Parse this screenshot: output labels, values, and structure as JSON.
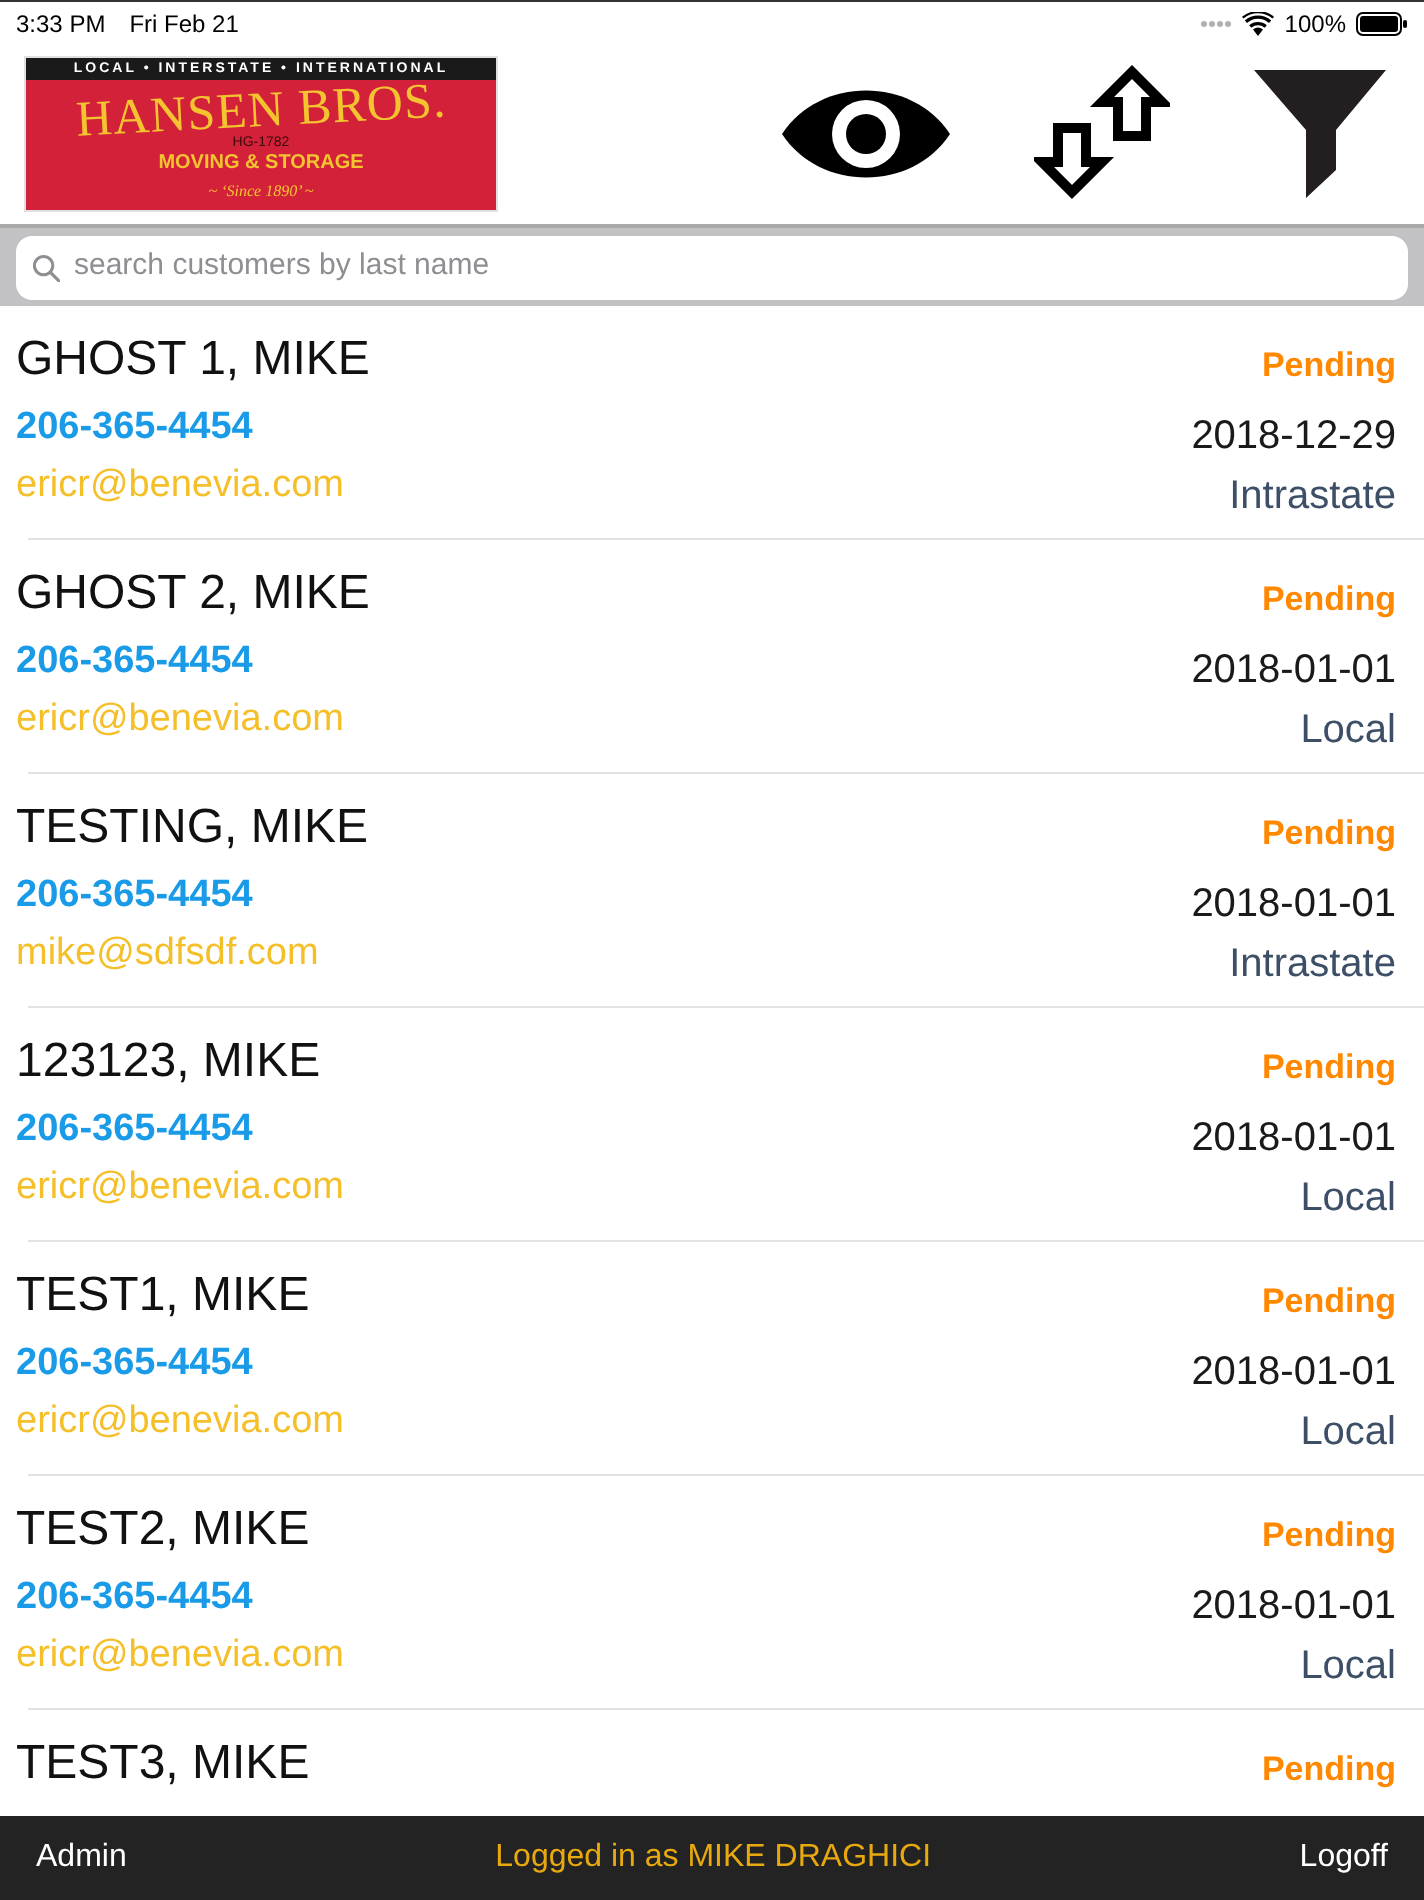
{
  "status_bar": {
    "time": "3:33 PM",
    "date": "Fri Feb 21",
    "battery": "100%"
  },
  "logo": {
    "tagline": "LOCAL • INTERSTATE • INTERNATIONAL",
    "name": "HANSEN BROS.",
    "license": "HG-1782",
    "subtitle": "MOVING & STORAGE",
    "since": "~ ‘Since 1890’ ~"
  },
  "search": {
    "placeholder": "search customers by last name"
  },
  "customers": [
    {
      "name": "GHOST 1, MIKE",
      "phone": "206-365-4454",
      "email": "ericr@benevia.com",
      "status": "Pending",
      "date": "2018-12-29",
      "move_type": "Intrastate"
    },
    {
      "name": "GHOST 2, MIKE",
      "phone": "206-365-4454",
      "email": "ericr@benevia.com",
      "status": "Pending",
      "date": "2018-01-01",
      "move_type": "Local"
    },
    {
      "name": "TESTING, MIKE",
      "phone": "206-365-4454",
      "email": "mike@sdfsdf.com",
      "status": "Pending",
      "date": "2018-01-01",
      "move_type": "Intrastate"
    },
    {
      "name": "123123, MIKE",
      "phone": "206-365-4454",
      "email": "ericr@benevia.com",
      "status": "Pending",
      "date": "2018-01-01",
      "move_type": "Local"
    },
    {
      "name": "TEST1, MIKE",
      "phone": "206-365-4454",
      "email": "ericr@benevia.com",
      "status": "Pending",
      "date": "2018-01-01",
      "move_type": "Local"
    },
    {
      "name": "TEST2, MIKE",
      "phone": "206-365-4454",
      "email": "ericr@benevia.com",
      "status": "Pending",
      "date": "2018-01-01",
      "move_type": "Local"
    },
    {
      "name": "TEST3, MIKE",
      "status": "Pending"
    }
  ],
  "footer": {
    "left": "Admin",
    "message": "Logged in as MIKE DRAGHICI",
    "right": "Logoff"
  }
}
